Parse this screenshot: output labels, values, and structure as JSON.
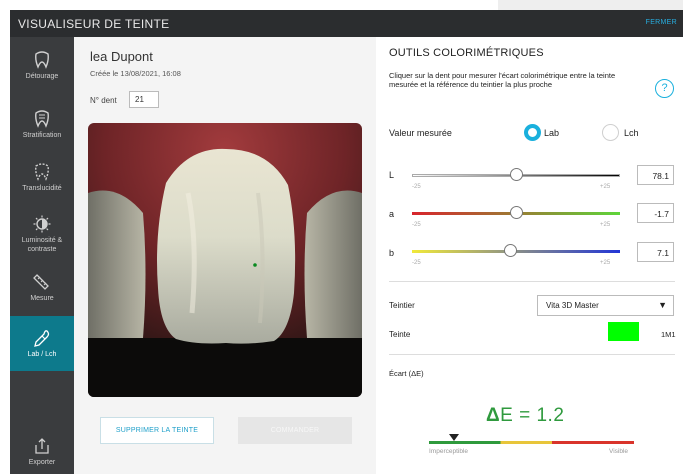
{
  "window": {
    "title": "VISUALISEUR DE TEINTE",
    "close_label": "FERMER"
  },
  "sidebar": {
    "items": [
      {
        "label": "Détourage",
        "icon": "tooth-outline-icon",
        "active": false
      },
      {
        "label": "Stratification",
        "icon": "tooth-layers-icon",
        "active": false
      },
      {
        "label": "Translucidité",
        "icon": "tooth-translucent-icon",
        "active": false
      },
      {
        "label": "Luminosité & contraste",
        "icon": "brightness-contrast-icon",
        "active": false
      },
      {
        "label": "Mesure",
        "icon": "ruler-icon",
        "active": false
      },
      {
        "label": "Lab / Lch",
        "icon": "pipette-icon",
        "active": true
      }
    ],
    "export_label": "Exporter"
  },
  "patient": {
    "name": "lea Dupont",
    "created": "Créée le 13/08/2021, 16:08",
    "tooth_number_label": "N° dent",
    "tooth_number": "21"
  },
  "actions": {
    "delete_label": "SUPPRIMER LA TEINTE",
    "order_label": "COMMANDER"
  },
  "tools": {
    "title": "OUTILS COLORIMÉTRIQUES",
    "description": "Cliquer sur la dent pour mesurer l'écart colorimétrique entre la teinte mesurée et la référence du teintier la plus proche",
    "help_label": "?",
    "measured_label": "Valeur mesurée",
    "modes": [
      {
        "label": "Lab",
        "selected": true
      },
      {
        "label": "Lch",
        "selected": false
      }
    ],
    "sliders": [
      {
        "name": "L",
        "min_label": "-25",
        "max_label": "+25",
        "value": "78.1",
        "position": 0.5,
        "colors": [
          "#ffffff",
          "#000000"
        ]
      },
      {
        "name": "a",
        "min_label": "-25",
        "max_label": "+25",
        "value": "-1.7",
        "position": 0.5,
        "colors": [
          "#d8242c",
          "#5dd53a"
        ]
      },
      {
        "name": "b",
        "min_label": "-25",
        "max_label": "+25",
        "value": "7.1",
        "position": 0.47,
        "colors": [
          "#f1e93a",
          "#2235d6"
        ]
      }
    ],
    "shade_guide_label": "Teintier",
    "shade_guide_value": "Vita 3D Master",
    "shade_label": "Teinte",
    "shade_value": "1M1",
    "shade_color": "#00ff00",
    "deviation_label": "Écart (ΔE)",
    "delta_symbol": "Δ",
    "delta_text": "E = 1.2",
    "delta_value": 1.2,
    "scale_min_label": "Imperceptible",
    "scale_max_label": "Visible",
    "scale_colors": [
      "#2e9a3c",
      "#e8c53a",
      "#d9342b"
    ]
  },
  "colors": {
    "accent": "#1ab0dd",
    "active_nav": "#0d7a8c",
    "delta_green": "#2f9a3e"
  }
}
